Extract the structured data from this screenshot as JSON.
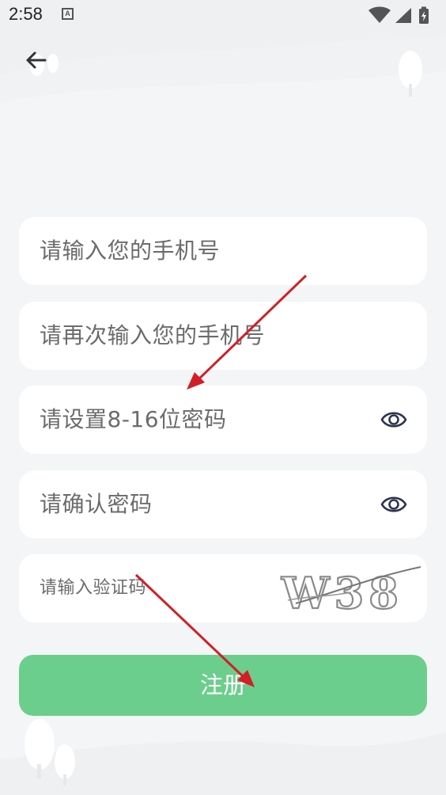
{
  "status_bar": {
    "time": "2:58",
    "notification_icon": "a-icon",
    "icons": [
      "wifi-icon",
      "signal-icon",
      "battery-charging-icon"
    ]
  },
  "header": {
    "back_icon": "arrow-left-icon"
  },
  "form": {
    "phone_placeholder": "请输入您的手机号",
    "phone_confirm_placeholder": "请再次输入您的手机号",
    "password_placeholder": "请设置8-16位密码",
    "password_confirm_placeholder": "请确认密码",
    "captcha_placeholder": "请输入验证码",
    "captcha_image_text": "W38",
    "eye_icon": "eye-icon"
  },
  "actions": {
    "register_label": "注册"
  },
  "colors": {
    "background": "#f4f5f6",
    "field": "#ffffff",
    "placeholder": "#6b6b6b",
    "register_button": "#6cce8c",
    "annotation_arrow": "#d21f26",
    "eye_icon": "#2e3350"
  }
}
